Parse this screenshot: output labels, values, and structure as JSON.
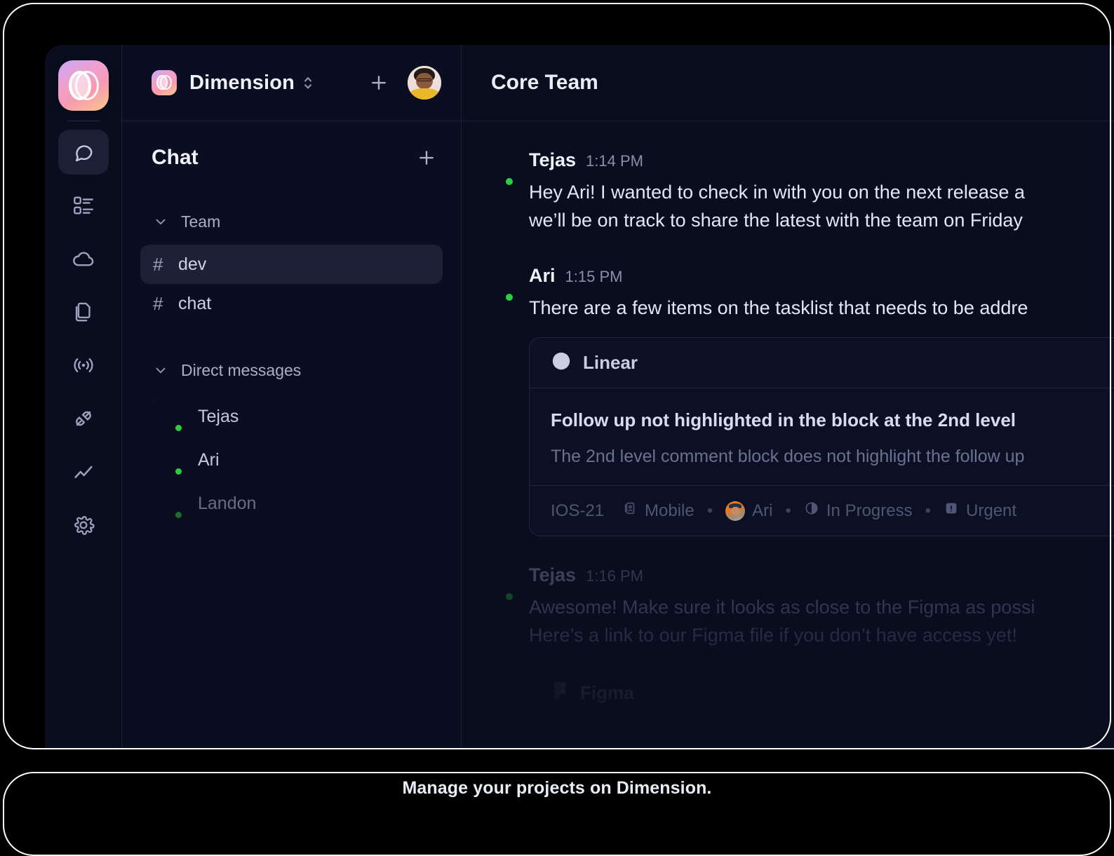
{
  "frame": {
    "caption": "Manage your projects on Dimension."
  },
  "icon_rail": {
    "brand": "dimension-logo",
    "items": [
      {
        "name": "chat-bubble-icon",
        "label": "Chat",
        "active": true
      },
      {
        "name": "tasks-list-icon",
        "label": "Tasks",
        "active": false
      },
      {
        "name": "cloud-icon",
        "label": "Cloud",
        "active": false
      },
      {
        "name": "documents-icon",
        "label": "Documents",
        "active": false
      },
      {
        "name": "broadcast-icon",
        "label": "Broadcast",
        "active": false
      },
      {
        "name": "plug-integrations-icon",
        "label": "Integrations",
        "active": false
      },
      {
        "name": "analytics-icon",
        "label": "Analytics",
        "active": false
      },
      {
        "name": "gear-icon",
        "label": "Settings",
        "active": false
      }
    ]
  },
  "workspace": {
    "name": "Dimension",
    "switcher_icon": "chevron-up-down-icon",
    "add_icon": "plus-icon",
    "avatar": "tejas-avatar"
  },
  "sidebar": {
    "title": "Chat",
    "add_icon": "plus-icon",
    "sections": [
      {
        "label": "Team",
        "collapse_icon": "chevron-down-icon",
        "channels": [
          {
            "hash": "#",
            "name": "dev",
            "active": true
          },
          {
            "hash": "#",
            "name": "chat",
            "active": false
          }
        ]
      },
      {
        "label": "Direct messages",
        "collapse_icon": "chevron-down-icon",
        "people": [
          {
            "name": "Tejas",
            "status": "online",
            "avatar": "tejas"
          },
          {
            "name": "Ari",
            "status": "online",
            "avatar": "ari"
          },
          {
            "name": "Landon",
            "status": "online",
            "avatar": "landon"
          }
        ]
      }
    ]
  },
  "conversation": {
    "title": "Core Team",
    "messages": [
      {
        "author": "Tejas",
        "time": "1:14 PM",
        "avatar": "tejas",
        "faded": false,
        "lines": [
          "Hey Ari! I wanted to check in with you on the next release a",
          "we’ll be on track to share the latest with the team on Friday"
        ]
      },
      {
        "author": "Ari",
        "time": "1:15 PM",
        "avatar": "ari",
        "faded": false,
        "lines": [
          "There are a few items on the tasklist that needs to be addre"
        ]
      },
      {
        "author": "Tejas",
        "time": "1:16 PM",
        "avatar": "tejas",
        "faded": true,
        "lines": [
          "Awesome! Make sure it looks as close to the Figma as possi",
          "Here’s a link to our Figma file if you don’t have access yet!"
        ]
      }
    ],
    "linear_card": {
      "app": "Linear",
      "app_icon": "linear-logo-icon",
      "title": "Follow up not highlighted in the block at the 2nd level",
      "description": "The 2nd level comment block does not highlight the follow up",
      "meta": {
        "id": "IOS-21",
        "project_icon": "mobile-project-icon",
        "project": "Mobile",
        "assignee": "Ari",
        "assignee_avatar": "ari",
        "status_icon": "in-progress-icon",
        "status": "In Progress",
        "priority_icon": "urgent-priority-icon",
        "priority": "Urgent",
        "separator": "•"
      }
    },
    "figma_card": {
      "app": "Figma",
      "app_icon": "figma-logo-icon"
    }
  },
  "colors": {
    "window_bg": "#0a0d1e",
    "sidebar_bg": "#0b0e20",
    "border": "#1b2038",
    "active_item": "#1d2138",
    "text_primary": "#eef0f8",
    "text_secondary": "#a9afc6",
    "text_muted": "#8990aa",
    "online": "#2ecc40",
    "frame_stroke": "#ffffff"
  }
}
